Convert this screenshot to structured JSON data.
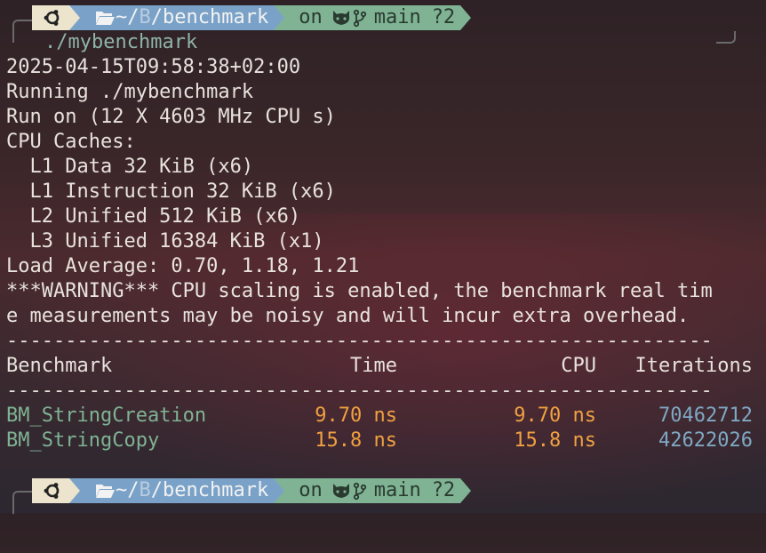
{
  "prompt": {
    "os_icon": "ubuntu-icon",
    "path_prefix": "~/",
    "path_dim": "B",
    "path_rest": "/benchmark",
    "git_on": "on",
    "git_branch": "main",
    "git_status": "?2"
  },
  "command": "./mybenchmark",
  "output": {
    "timestamp": "2025-04-15T09:58:38+02:00",
    "running": "Running ./mybenchmark",
    "run_on": "Run on (12 X 4603 MHz CPU s)",
    "cpu_caches": "CPU Caches:",
    "l1_data": "  L1 Data 32 KiB (x6)",
    "l1_instruction": "  L1 Instruction 32 KiB (x6)",
    "l2": "  L2 Unified 512 KiB (x6)",
    "l3": "  L3 Unified 16384 KiB (x1)",
    "load_average": "Load Average: 0.70, 1.18, 1.21",
    "warning_1": "***WARNING*** CPU scaling is enabled, the benchmark real tim",
    "warning_2": "e measurements may be noisy and will incur extra overhead.",
    "separator": "------------------------------------------------------------"
  },
  "table": {
    "headers": {
      "benchmark": "Benchmark",
      "time": "Time",
      "cpu": "CPU",
      "iterations": "Iterations"
    },
    "rows": [
      {
        "name": "BM_StringCreation",
        "time": "9.70 ns",
        "cpu": "9.70 ns",
        "iterations": "70462712"
      },
      {
        "name": "BM_StringCopy",
        "time": "15.8 ns",
        "cpu": "15.8 ns",
        "iterations": "42622026"
      }
    ]
  },
  "colors": {
    "os_segment": "#ece4cc",
    "path_segment": "#7aa2c8",
    "git_segment": "#7fb394",
    "benchmark_name": "#7fb394",
    "timing": "#f0a040",
    "iterations": "#7fa8c4"
  }
}
